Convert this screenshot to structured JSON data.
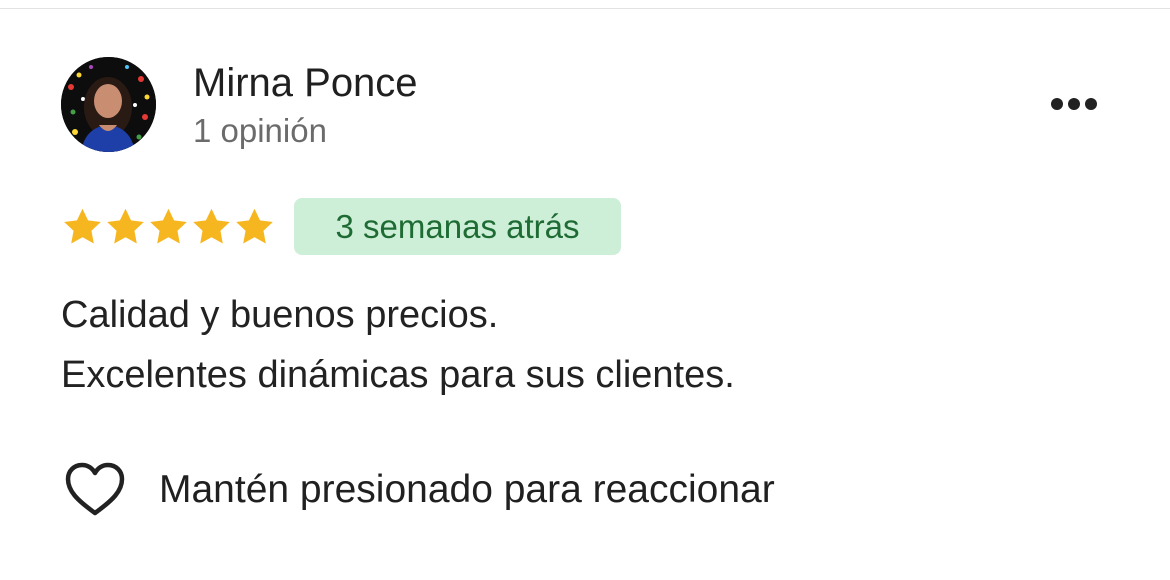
{
  "review": {
    "reviewer_name": "Mirna Ponce",
    "review_count": "1 opinión",
    "rating": 5,
    "rating_max": 5,
    "time_ago": "3 semanas atrás",
    "text_lines": [
      "Calidad y buenos precios.",
      "Excelentes dinámicas para sus clientes."
    ]
  },
  "actions": {
    "react_label": "Mantén presionado para reaccionar",
    "more_icon": "more-horizontal-icon",
    "react_icon": "heart-outline-icon"
  },
  "colors": {
    "star": "#F6B620",
    "badge_bg": "#CDEED7",
    "badge_text": "#1E6B34",
    "secondary_text": "#6B6B6B"
  }
}
